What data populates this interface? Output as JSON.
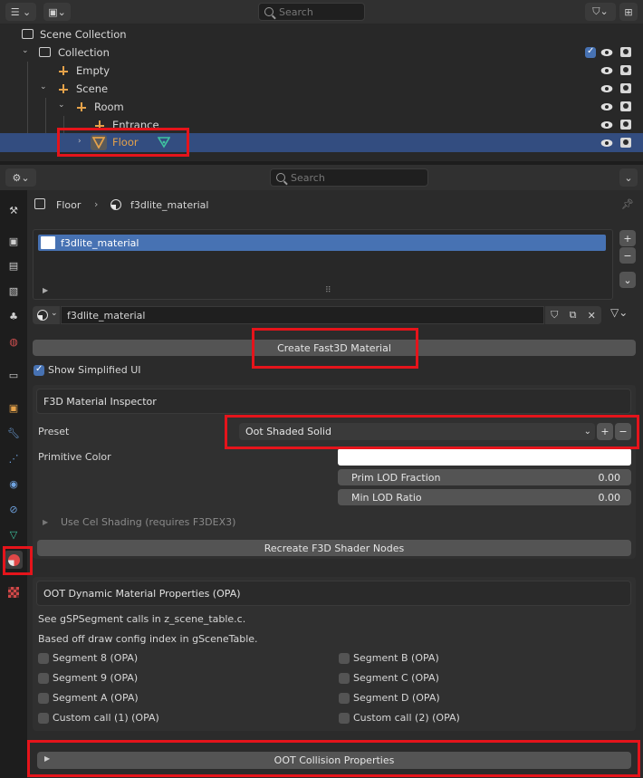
{
  "outliner": {
    "search_placeholder": "Search",
    "rows": [
      {
        "label": "Scene Collection"
      },
      {
        "label": "Collection"
      },
      {
        "label": "Empty"
      },
      {
        "label": "Scene"
      },
      {
        "label": "Room"
      },
      {
        "label": "Entrance"
      },
      {
        "label": "Floor"
      }
    ]
  },
  "properties": {
    "search_placeholder": "Search",
    "breadcrumb": {
      "object": "Floor",
      "material": "f3dlite_material"
    },
    "material_slot": "f3dlite_material",
    "material_name": "f3dlite_material",
    "create_button": "Create Fast3D Material",
    "show_simplified": "Show Simplified UI",
    "inspector": {
      "title": "F3D Material Inspector",
      "preset_label": "Preset",
      "preset_value": "Oot Shaded Solid",
      "primitive_color_label": "Primitive Color",
      "prim_lod_label": "Prim LOD Fraction",
      "prim_lod_value": "0.00",
      "min_lod_label": "Min LOD Ratio",
      "min_lod_value": "0.00",
      "cel_shading": "Use Cel Shading (requires F3DEX3)",
      "recreate_button": "Recreate F3D Shader Nodes"
    },
    "oot_dynamic": {
      "title": "OOT Dynamic Material Properties (OPA)",
      "note1": "See gSPSegment calls in z_scene_table.c.",
      "note2": "Based off draw config index in gSceneTable.",
      "segments_left": [
        "Segment 8 (OPA)",
        "Segment 9 (OPA)",
        "Segment A (OPA)",
        "Custom call (1) (OPA)"
      ],
      "segments_right": [
        "Segment B (OPA)",
        "Segment C (OPA)",
        "Segment D (OPA)",
        "Custom call (2) (OPA)"
      ]
    },
    "collision_panel": "OOT Collision Properties"
  },
  "colors": {
    "selection": "#334d80",
    "accent_orange": "#e5a24a",
    "mesh_green": "#3fc4a0",
    "highlight_red": "#e5141b"
  }
}
